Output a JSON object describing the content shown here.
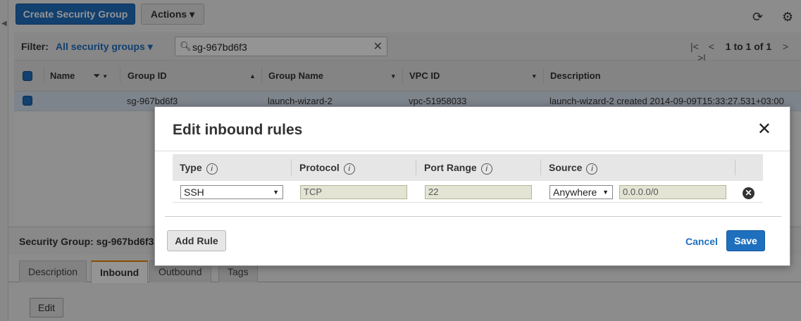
{
  "toolbar": {
    "create_label": "Create Security Group",
    "actions_label": "Actions ▾",
    "refresh_icon": "refresh-icon",
    "settings_icon": "gear-icon"
  },
  "filter": {
    "label": "Filter:",
    "value": "All security groups ▾",
    "search_value": "sg-967bd6f3"
  },
  "pager": {
    "text": "1 to 1 of 1"
  },
  "table": {
    "columns": [
      "Name",
      "Group ID",
      "Group Name",
      "VPC ID",
      "Description"
    ],
    "rows": [
      {
        "name": "",
        "group_id": "sg-967bd6f3",
        "group_name": "launch-wizard-2",
        "vpc_id": "vpc-51958033",
        "description": "launch-wizard-2 created 2014-09-09T15:33:27.531+03:00"
      }
    ]
  },
  "details": {
    "title": "Security Group: sg-967bd6f3",
    "tabs": [
      "Description",
      "Inbound",
      "Outbound",
      "Tags"
    ],
    "edit_label": "Edit"
  },
  "modal": {
    "title": "Edit inbound rules",
    "close_glyph": "✕",
    "headers": [
      "Type",
      "Protocol",
      "Port Range",
      "Source"
    ],
    "info_glyph": "i",
    "rule": {
      "type": "SSH",
      "protocol": "TCP",
      "port_range": "22",
      "source_type": "Anywhere",
      "source_cidr": "0.0.0.0/0"
    },
    "add_rule_label": "Add Rule",
    "cancel_label": "Cancel",
    "save_label": "Save"
  },
  "colors": {
    "primary": "#1f6fbf",
    "active_tab_accent": "#e58a00"
  }
}
